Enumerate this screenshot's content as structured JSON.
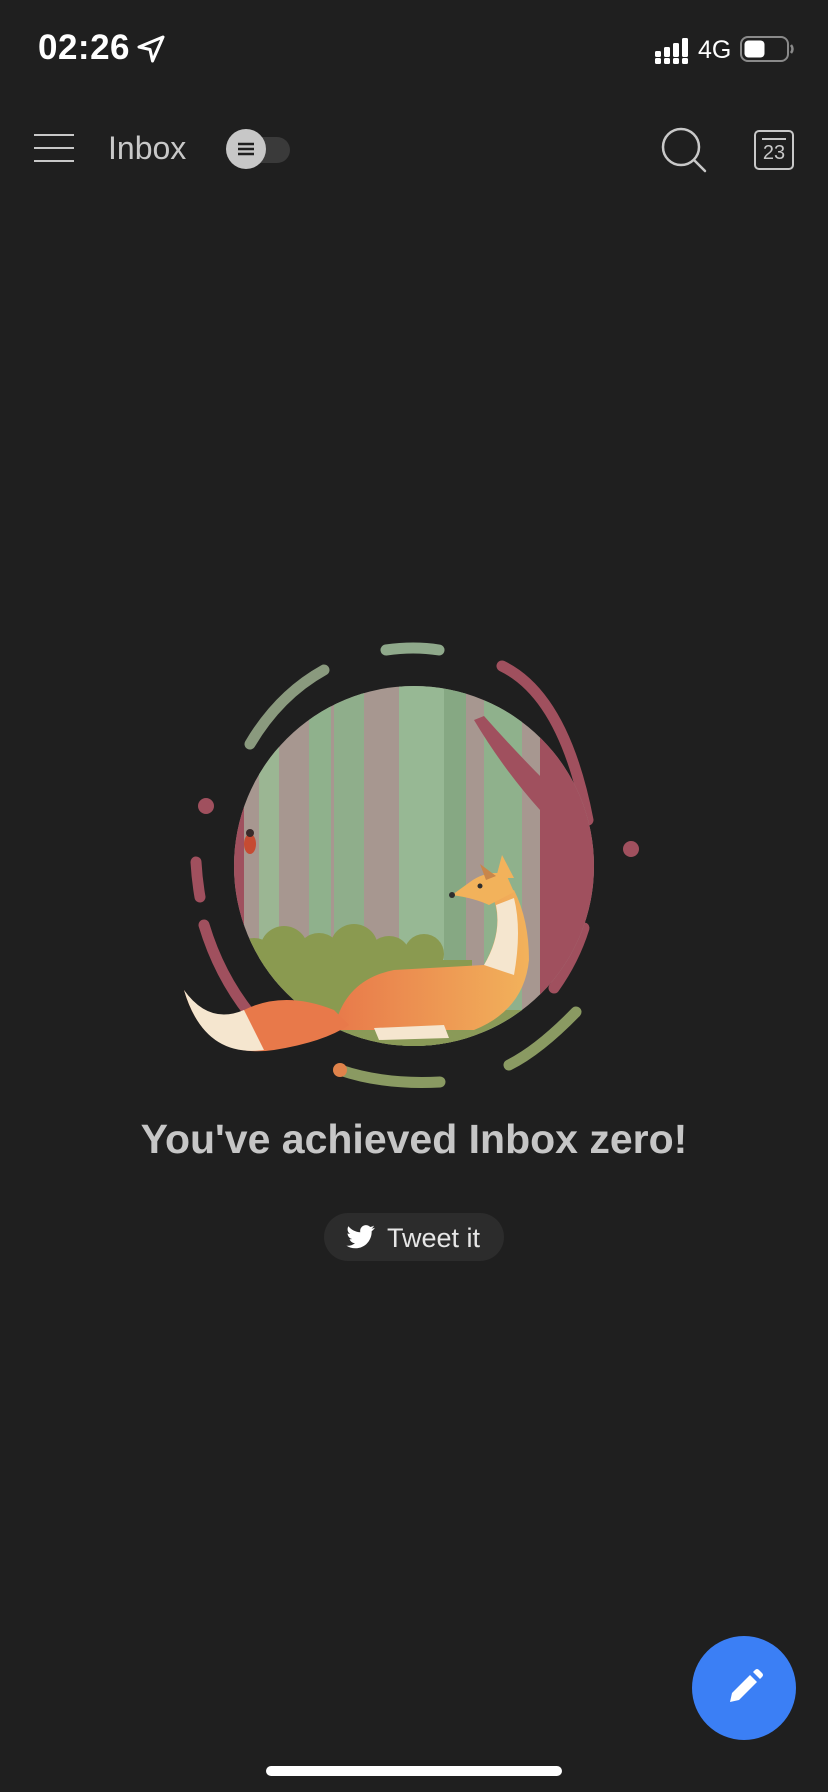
{
  "status_bar": {
    "time": "02:26",
    "network": "4G"
  },
  "header": {
    "title": "Inbox",
    "calendar_day": "23"
  },
  "empty_state": {
    "message": "You've achieved Inbox zero!",
    "tweet_label": "Tweet it"
  },
  "icons": {
    "menu": "menu-icon",
    "toggle": "list-icon",
    "search": "search-icon",
    "calendar": "calendar-icon",
    "twitter": "twitter-icon",
    "compose": "pencil-icon"
  },
  "colors": {
    "background": "#1f1f1f",
    "accent": "#3b7ff5",
    "text": "#c6c6c6"
  }
}
